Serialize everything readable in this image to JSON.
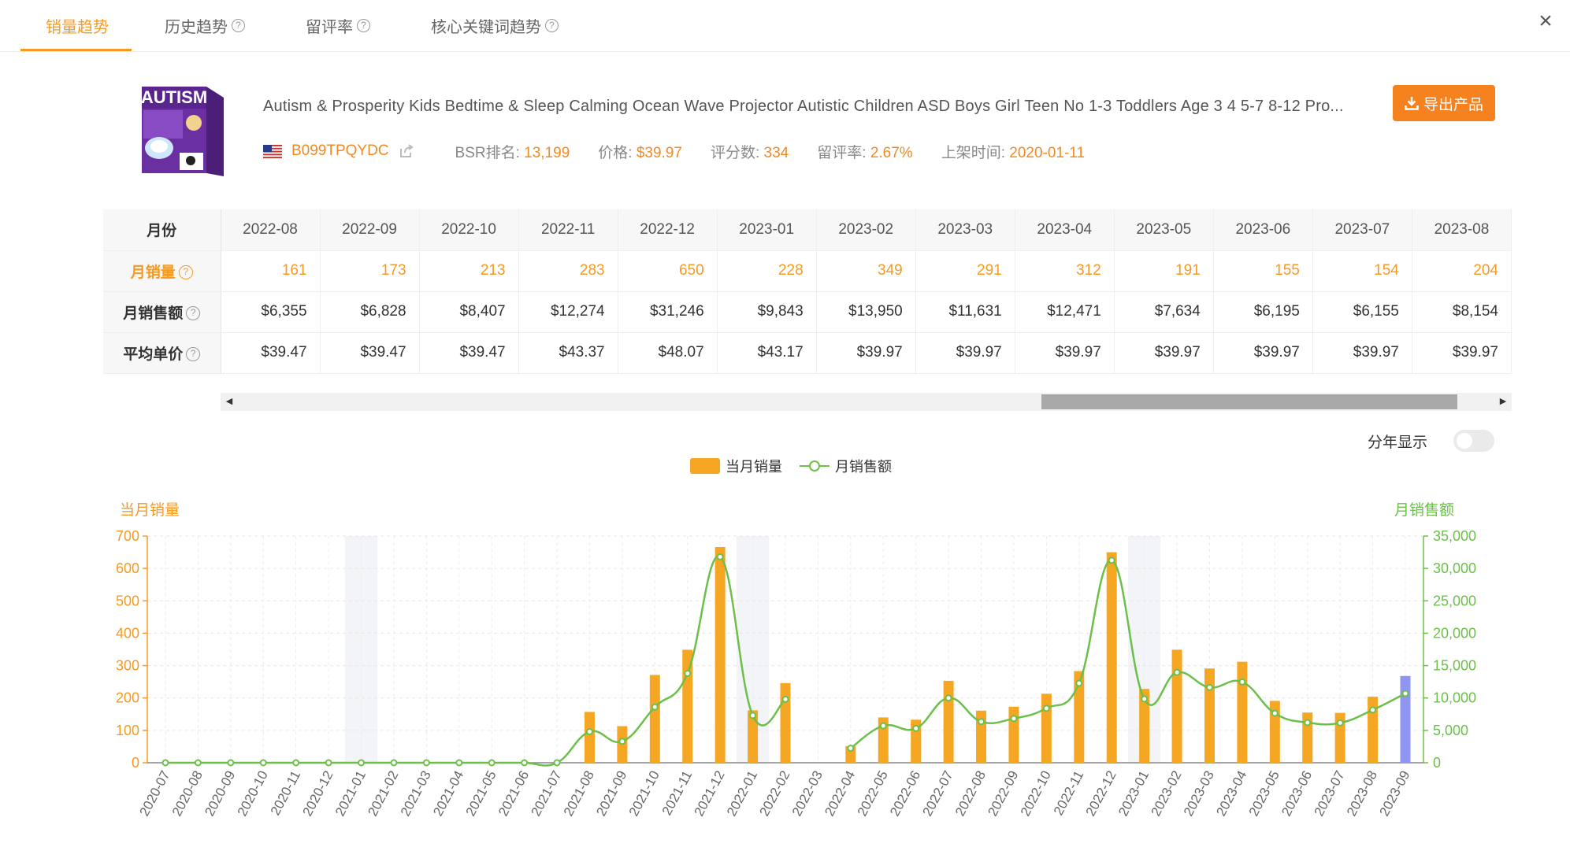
{
  "tabs": [
    {
      "label": "销量趋势",
      "help": false
    },
    {
      "label": "历史趋势",
      "help": true
    },
    {
      "label": "留评率",
      "help": true
    },
    {
      "label": "核心关键词趋势",
      "help": true
    }
  ],
  "close_icon": "×",
  "product": {
    "image_alt": "product-image",
    "image_text": "AUTISM",
    "title": "Autism & Prosperity Kids Bedtime & Sleep Calming Ocean Wave Projector Autistic Children ASD Boys Girl Teen No 1-3 Toddlers Age 3 4 5-7 8-12 Pro...",
    "asin": "B099TPQYDC",
    "bsr_label": "BSR排名: ",
    "bsr": "13,199",
    "price_label": "价格: ",
    "price": "$39.97",
    "rating_label": "评分数: ",
    "rating_count": "334",
    "review_rate_label": "留评率: ",
    "review_rate": "2.67%",
    "launch_label": "上架时间: ",
    "launch_date": "2020-01-11"
  },
  "export_button": "导出产品",
  "table": {
    "header_label": "月份",
    "months": [
      "2022-08",
      "2022-09",
      "2022-10",
      "2022-11",
      "2022-12",
      "2023-01",
      "2023-02",
      "2023-03",
      "2023-04",
      "2023-05",
      "2023-06",
      "2023-07",
      "2023-08"
    ],
    "rows": [
      {
        "label": "月销量",
        "values": [
          "161",
          "173",
          "213",
          "283",
          "650",
          "228",
          "349",
          "291",
          "312",
          "191",
          "155",
          "154",
          "204"
        ]
      },
      {
        "label": "月销售额",
        "values": [
          "$6,355",
          "$6,828",
          "$8,407",
          "$12,274",
          "$31,246",
          "$9,843",
          "$13,950",
          "$11,631",
          "$12,471",
          "$7,634",
          "$6,195",
          "$6,155",
          "$8,154"
        ]
      },
      {
        "label": "平均单价",
        "values": [
          "$39.47",
          "$39.47",
          "$39.47",
          "$43.37",
          "$48.07",
          "$43.17",
          "$39.97",
          "$39.97",
          "$39.97",
          "$39.97",
          "$39.97",
          "$39.97",
          "$39.97"
        ]
      }
    ]
  },
  "toggle_label": "分年显示",
  "colors": {
    "accent": "#f59a23",
    "bar": "#f5a623",
    "bar_current": "#8f96f2",
    "line": "#6cc04a",
    "button": "#f5821f"
  },
  "chart_data": {
    "type": "bar",
    "left_axis_title": "当月销量",
    "right_axis_title": "月销售额",
    "legend": [
      "当月销量",
      "月销售额"
    ],
    "legend_placement": "top-center",
    "grid": true,
    "x": [
      "2020-07",
      "2020-08",
      "2020-09",
      "2020-10",
      "2020-11",
      "2020-12",
      "2021-01",
      "2021-02",
      "2021-03",
      "2021-04",
      "2021-05",
      "2021-06",
      "2021-07",
      "2021-08",
      "2021-09",
      "2021-10",
      "2021-11",
      "2021-12",
      "2022-01",
      "2022-02",
      "2022-03",
      "2022-04",
      "2022-05",
      "2022-06",
      "2022-07",
      "2022-08",
      "2022-09",
      "2022-10",
      "2022-11",
      "2022-12",
      "2023-01",
      "2023-02",
      "2023-03",
      "2023-04",
      "2023-05",
      "2023-06",
      "2023-07",
      "2023-08",
      "2023-09"
    ],
    "y_left_range": [
      0,
      700
    ],
    "y_left_ticks": [
      "0",
      "100",
      "200",
      "300",
      "400",
      "500",
      "600",
      "700"
    ],
    "y_right_range": [
      0,
      35000
    ],
    "y_right_ticks": [
      "0",
      "5,000",
      "10,000",
      "15,000",
      "20,000",
      "25,000",
      "30,000",
      "35,000"
    ],
    "highlight_bands": [
      "2021-01",
      "2022-01",
      "2023-01"
    ],
    "series": [
      {
        "name": "当月销量",
        "type": "bar",
        "values": [
          0,
          0,
          0,
          0,
          0,
          0,
          0,
          0,
          0,
          0,
          0,
          0,
          0,
          157,
          113,
          271,
          349,
          666,
          162,
          246,
          0,
          51,
          140,
          133,
          253,
          161,
          173,
          213,
          283,
          650,
          228,
          349,
          291,
          312,
          191,
          155,
          154,
          204,
          268
        ]
      },
      {
        "name": "月销售额",
        "type": "line",
        "values": [
          0,
          0,
          0,
          0,
          0,
          0,
          0,
          0,
          0,
          0,
          0,
          0,
          0,
          4800,
          3300,
          8600,
          13800,
          31800,
          7300,
          9800,
          null,
          2250,
          5700,
          5300,
          10000,
          6355,
          6828,
          8407,
          12274,
          31246,
          9843,
          13950,
          11631,
          12471,
          7634,
          6195,
          6155,
          8154,
          10700
        ]
      }
    ]
  }
}
